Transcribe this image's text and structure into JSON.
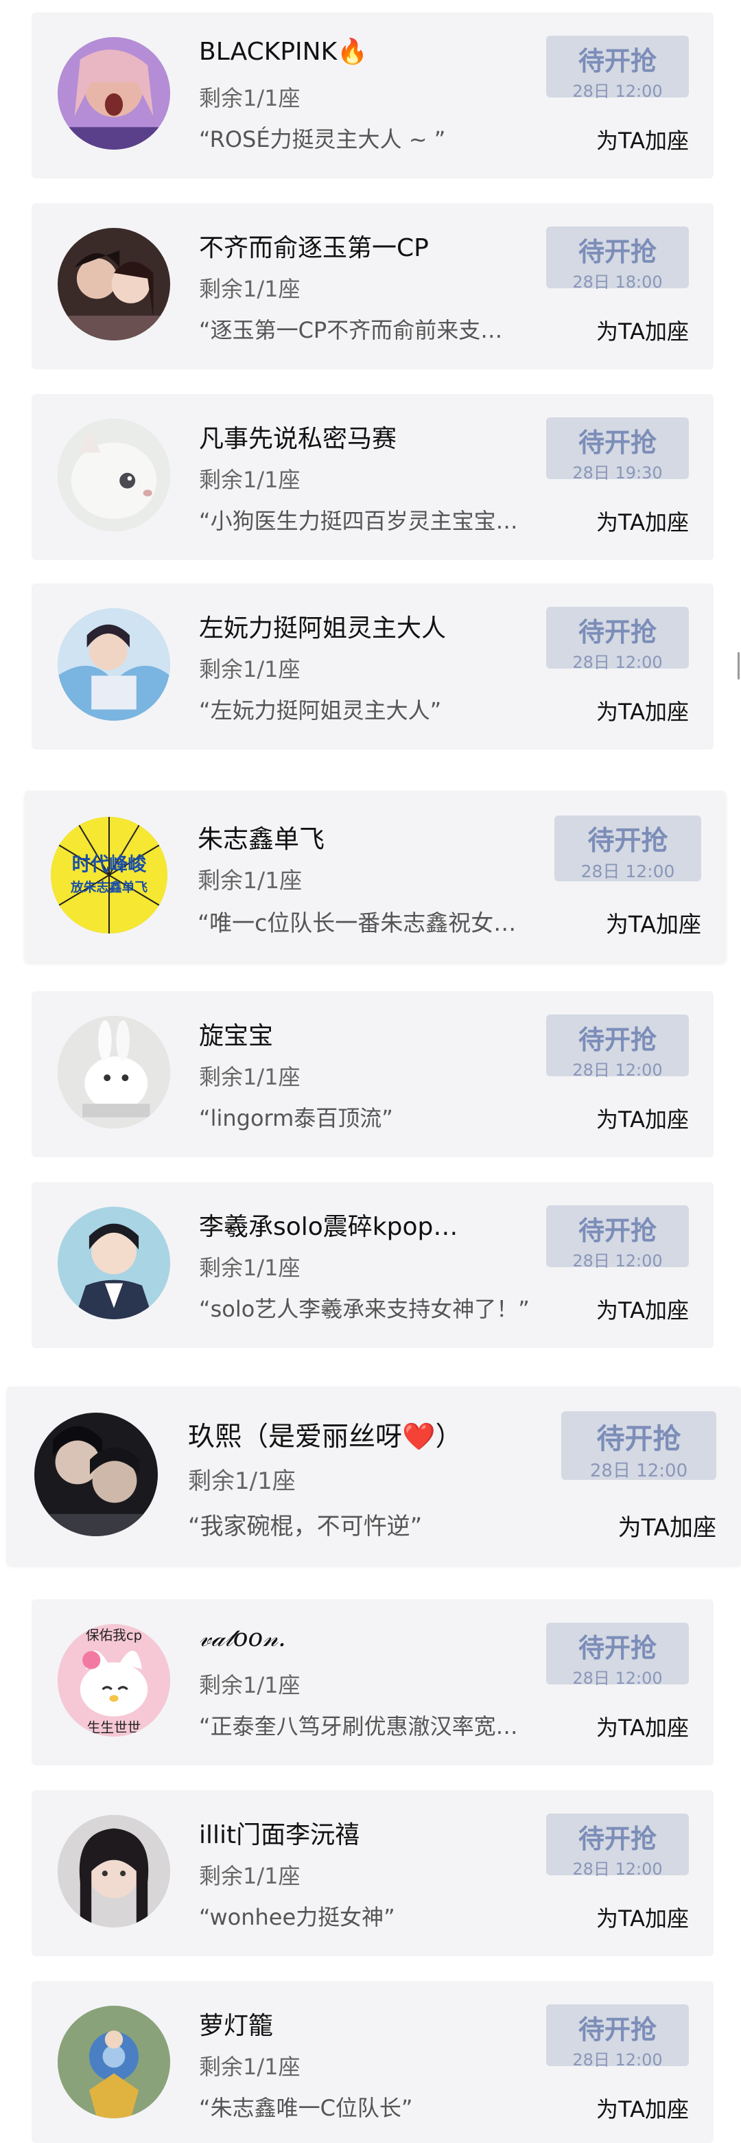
{
  "cards": [
    {
      "name": "BLACKPINK",
      "emoji": "🔥",
      "seats": "剩余1/1座",
      "quote": "“ROSÉ力挺灵主大人 ~ ”",
      "btn_label": "待开抢",
      "btn_time": "28日 12:00",
      "add_label": "为TA加座"
    },
    {
      "name": "不齐而俞逐玉第一CP",
      "emoji": "",
      "seats": "剩余1/1座",
      "quote": "“逐玉第一CP不齐而俞前来支…",
      "btn_label": "待开抢",
      "btn_time": "28日 18:00",
      "add_label": "为TA加座"
    },
    {
      "name": "凡事先说私密马赛",
      "emoji": "",
      "seats": "剩余1/1座",
      "quote": "“小狗医生力挺四百岁灵主宝宝…",
      "btn_label": "待开抢",
      "btn_time": "28日 19:30",
      "add_label": "为TA加座"
    },
    {
      "name": "左妧力挺阿姐灵主大人",
      "emoji": "",
      "seats": "剩余1/1座",
      "quote": "“左妧力挺阿姐灵主大人”",
      "btn_label": "待开抢",
      "btn_time": "28日 12:00",
      "add_label": "为TA加座"
    },
    {
      "name": "朱志鑫单飞",
      "emoji": "",
      "seats": "剩余1/1座",
      "quote": "“唯一c位队长一番朱志鑫祝女…",
      "btn_label": "待开抢",
      "btn_time": "28日 12:00",
      "add_label": "为TA加座",
      "avatar_text_1": "时代峰峻",
      "avatar_text_2": "放朱志鑫单飞"
    },
    {
      "name": "旋宝宝",
      "emoji": "",
      "seats": "剩余1/1座",
      "quote": "“lingorm泰百顶流”",
      "btn_label": "待开抢",
      "btn_time": "28日 12:00",
      "add_label": "为TA加座"
    },
    {
      "name": "李羲承solo震碎kpop…",
      "emoji": "",
      "seats": "剩余1/1座",
      "quote": "“solo艺人李羲承来支持女神了！”",
      "btn_label": "待开抢",
      "btn_time": "28日 12:00",
      "add_label": "为TA加座"
    },
    {
      "name": "玖熙（是爱丽丝呀",
      "emoji": "❤️",
      "name_tail": "）",
      "seats": "剩余1/1座",
      "quote": "“我家碗棍，不可忤逆”",
      "btn_label": "待开抢",
      "btn_time": "28日 12:00",
      "add_label": "为TA加座"
    },
    {
      "name": "𝓋𝒶𝓉𝑜𝑜𝓃.",
      "emoji": "",
      "seats": "剩余1/1座",
      "quote": "“正泰奎八笃牙刷优惠澈汉率宽…",
      "btn_label": "待开抢",
      "btn_time": "28日 12:00",
      "add_label": "为TA加座",
      "avatar_text_1": "保佑我cp",
      "avatar_text_2": "生生世世"
    },
    {
      "name": "illit门面李沅禧",
      "emoji": "",
      "seats": "剩余1/1座",
      "quote": "“wonhee力挺女神”",
      "btn_label": "待开抢",
      "btn_time": "28日 12:00",
      "add_label": "为TA加座"
    },
    {
      "name": "萝灯籠",
      "emoji": "",
      "seats": "剩余1/1座",
      "quote": "“朱志鑫唯一C位队长”",
      "btn_label": "待开抢",
      "btn_time": "28日 12:00",
      "add_label": "为TA加座"
    }
  ]
}
